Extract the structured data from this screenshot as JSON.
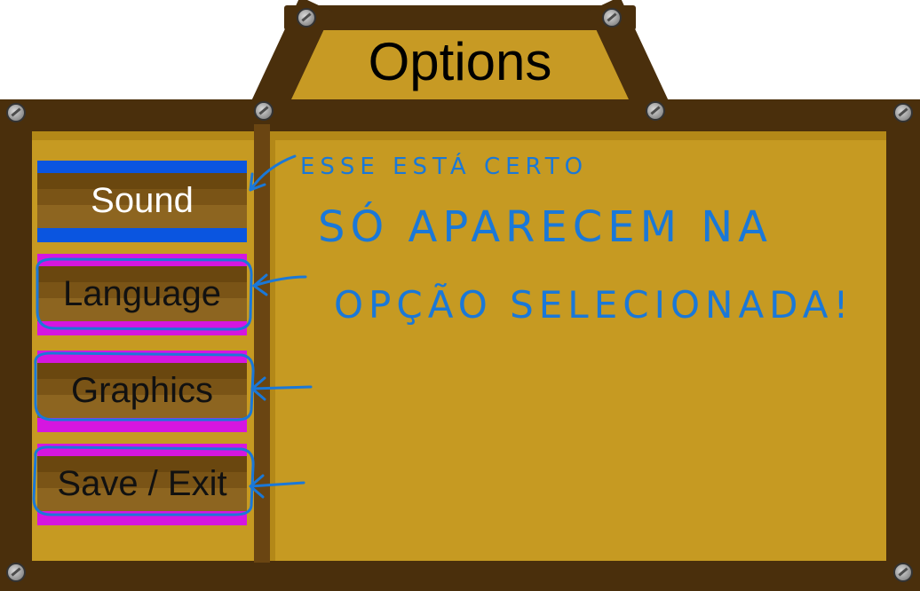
{
  "title": "Options",
  "menu": {
    "items": [
      {
        "label": "Sound",
        "state": "selected"
      },
      {
        "label": "Language",
        "state": "unselected"
      },
      {
        "label": "Graphics",
        "state": "unselected"
      },
      {
        "label": "Save / Exit",
        "state": "unselected"
      }
    ]
  },
  "annotation": {
    "note_1": "ESSE ESTÁ CERTO",
    "note_2_line1": "SÓ APARECEM NA",
    "note_2_line2": "OPÇÃO SELECIONADA!"
  },
  "colors": {
    "frame": "#4a2f0c",
    "board": "#c69a22",
    "selected_border": "#0a55e0",
    "unselected_border": "#d516e0",
    "annotation_ink": "#1a78d8"
  }
}
